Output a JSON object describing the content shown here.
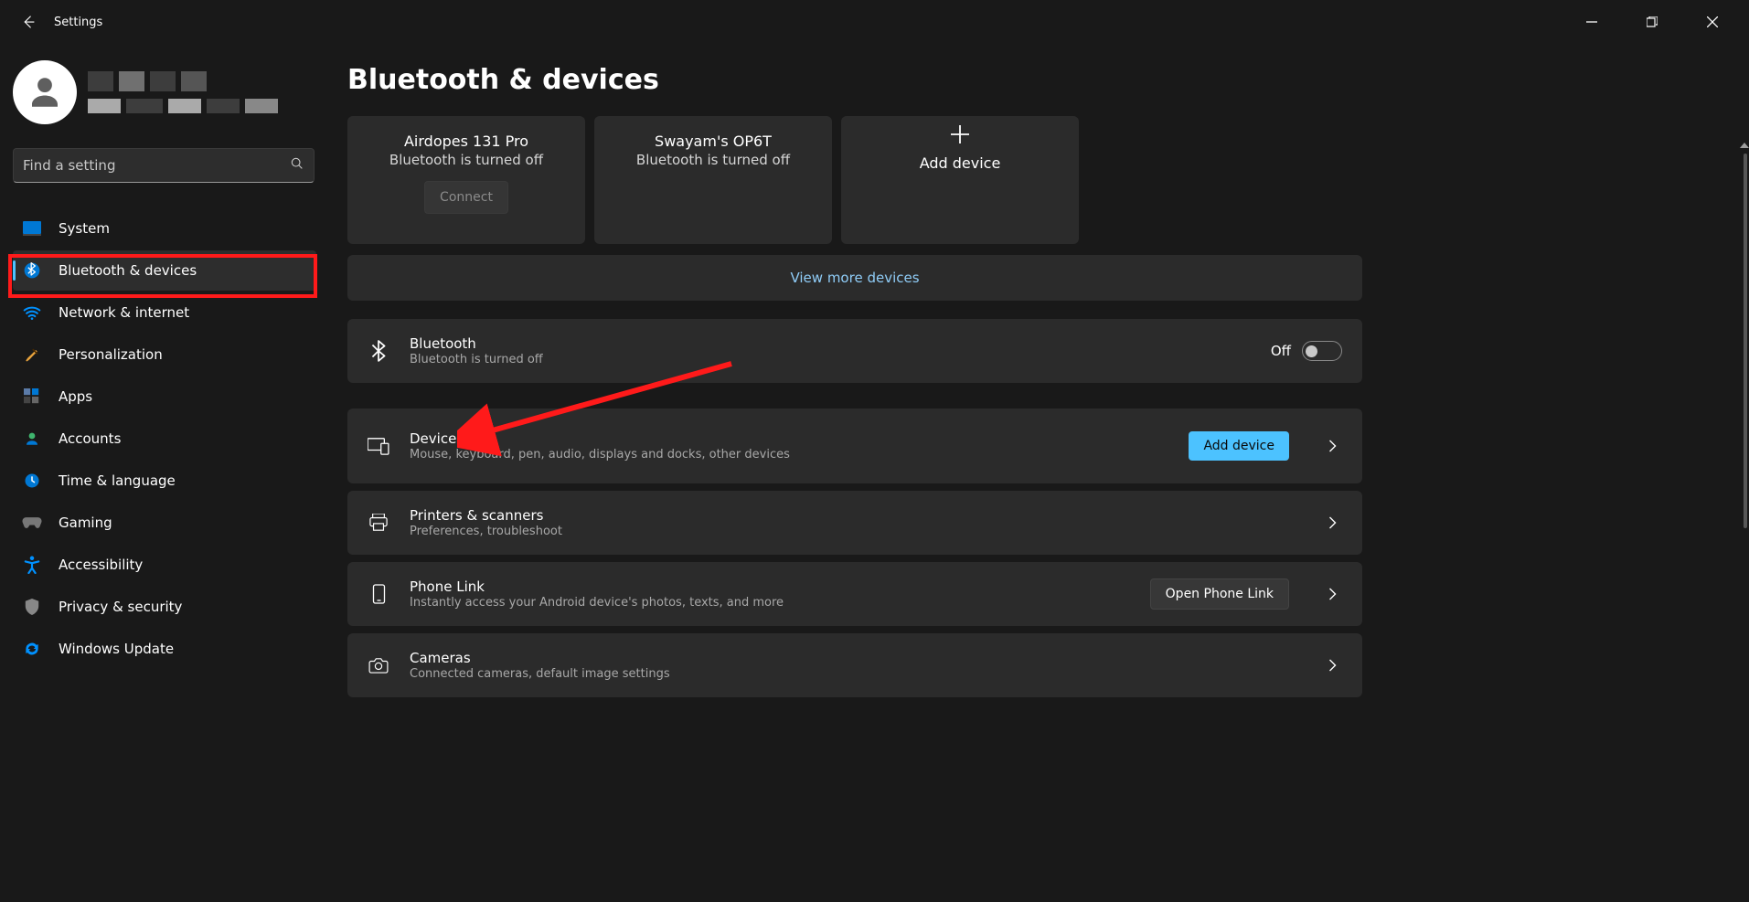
{
  "title": "Settings",
  "header": {
    "pageTitle": "Bluetooth & devices"
  },
  "search": {
    "placeholder": "Find a setting"
  },
  "sidebar": {
    "items": [
      {
        "label": "System",
        "icon": "system"
      },
      {
        "label": "Bluetooth & devices",
        "icon": "bluetooth",
        "active": true
      },
      {
        "label": "Network & internet",
        "icon": "wifi"
      },
      {
        "label": "Personalization",
        "icon": "brush"
      },
      {
        "label": "Apps",
        "icon": "apps"
      },
      {
        "label": "Accounts",
        "icon": "person"
      },
      {
        "label": "Time & language",
        "icon": "clock"
      },
      {
        "label": "Gaming",
        "icon": "gaming"
      },
      {
        "label": "Accessibility",
        "icon": "accessibility"
      },
      {
        "label": "Privacy & security",
        "icon": "shield"
      },
      {
        "label": "Windows Update",
        "icon": "update"
      }
    ]
  },
  "devices": [
    {
      "name": "Airdopes 131 Pro",
      "sub": "Bluetooth is turned off",
      "connectLabel": "Connect"
    },
    {
      "name": "Swayam's OP6T",
      "sub": "Bluetooth is turned off"
    }
  ],
  "addDevice": {
    "label": "Add device"
  },
  "viewMore": "View more devices",
  "bluetoothSetting": {
    "title": "Bluetooth",
    "sub": "Bluetooth is turned off",
    "toggleLabel": "Off"
  },
  "rows": {
    "devices": {
      "title": "Devices",
      "sub": "Mouse, keyboard, pen, audio, displays and docks, other devices",
      "btn": "Add device"
    },
    "printers": {
      "title": "Printers & scanners",
      "sub": "Preferences, troubleshoot"
    },
    "phonelink": {
      "title": "Phone Link",
      "sub": "Instantly access your Android device's photos, texts, and more",
      "btn": "Open Phone Link"
    },
    "cameras": {
      "title": "Cameras",
      "sub": "Connected cameras, default image settings"
    }
  }
}
